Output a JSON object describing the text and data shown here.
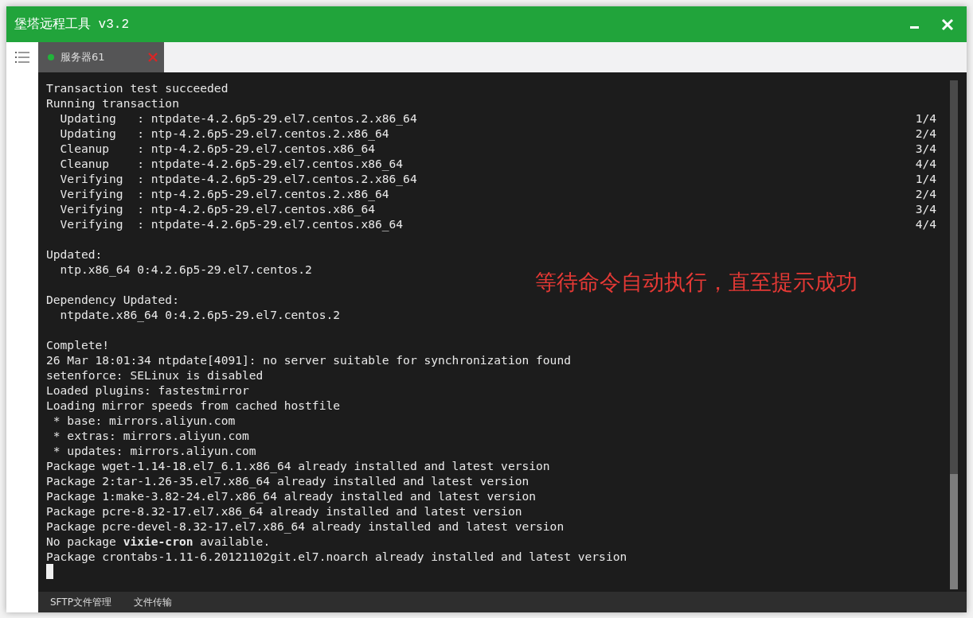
{
  "window": {
    "title": "堡塔远程工具 v3.2"
  },
  "tabs": [
    {
      "label": "服务器61",
      "selected": true,
      "connected": true
    }
  ],
  "terminal": {
    "lines": [
      {
        "kind": "text",
        "text": "Transaction test succeeded"
      },
      {
        "kind": "text",
        "text": "Running transaction"
      },
      {
        "kind": "text",
        "text": "  Updating   : ntpdate-4.2.6p5-29.el7.centos.2.x86_64",
        "count": "1/4"
      },
      {
        "kind": "text",
        "text": "  Updating   : ntp-4.2.6p5-29.el7.centos.2.x86_64",
        "count": "2/4"
      },
      {
        "kind": "text",
        "text": "  Cleanup    : ntp-4.2.6p5-29.el7.centos.x86_64",
        "count": "3/4"
      },
      {
        "kind": "text",
        "text": "  Cleanup    : ntpdate-4.2.6p5-29.el7.centos.x86_64",
        "count": "4/4"
      },
      {
        "kind": "text",
        "text": "  Verifying  : ntpdate-4.2.6p5-29.el7.centos.2.x86_64",
        "count": "1/4"
      },
      {
        "kind": "text",
        "text": "  Verifying  : ntp-4.2.6p5-29.el7.centos.2.x86_64",
        "count": "2/4"
      },
      {
        "kind": "text",
        "text": "  Verifying  : ntp-4.2.6p5-29.el7.centos.x86_64",
        "count": "3/4"
      },
      {
        "kind": "text",
        "text": "  Verifying  : ntpdate-4.2.6p5-29.el7.centos.x86_64",
        "count": "4/4"
      },
      {
        "kind": "blank"
      },
      {
        "kind": "text",
        "text": "Updated:"
      },
      {
        "kind": "text",
        "text": "  ntp.x86_64 0:4.2.6p5-29.el7.centos.2"
      },
      {
        "kind": "blank"
      },
      {
        "kind": "text",
        "text": "Dependency Updated:"
      },
      {
        "kind": "text",
        "text": "  ntpdate.x86_64 0:4.2.6p5-29.el7.centos.2"
      },
      {
        "kind": "blank"
      },
      {
        "kind": "text",
        "text": "Complete!"
      },
      {
        "kind": "text",
        "text": "26 Mar 18:01:34 ntpdate[4091]: no server suitable for synchronization found"
      },
      {
        "kind": "text",
        "text": "setenforce: SELinux is disabled"
      },
      {
        "kind": "text",
        "text": "Loaded plugins: fastestmirror"
      },
      {
        "kind": "text",
        "text": "Loading mirror speeds from cached hostfile"
      },
      {
        "kind": "text",
        "text": " * base: mirrors.aliyun.com"
      },
      {
        "kind": "text",
        "text": " * extras: mirrors.aliyun.com"
      },
      {
        "kind": "text",
        "text": " * updates: mirrors.aliyun.com"
      },
      {
        "kind": "text",
        "text": "Package wget-1.14-18.el7_6.1.x86_64 already installed and latest version"
      },
      {
        "kind": "text",
        "text": "Package 2:tar-1.26-35.el7.x86_64 already installed and latest version"
      },
      {
        "kind": "text",
        "text": "Package 1:make-3.82-24.el7.x86_64 already installed and latest version"
      },
      {
        "kind": "text",
        "text": "Package pcre-8.32-17.el7.x86_64 already installed and latest version"
      },
      {
        "kind": "text",
        "text": "Package pcre-devel-8.32-17.el7.x86_64 already installed and latest version"
      },
      {
        "kind": "text",
        "text": "No package **vixie-cron** available."
      },
      {
        "kind": "text",
        "text": "Package crontabs-1.11-6.20121102git.el7.noarch already installed and latest version"
      },
      {
        "kind": "cursor"
      }
    ],
    "annotation": "等待命令自动执行，直至提示成功"
  },
  "bottom_tabs": [
    {
      "label": "SFTP文件管理"
    },
    {
      "label": "文件传输"
    }
  ]
}
